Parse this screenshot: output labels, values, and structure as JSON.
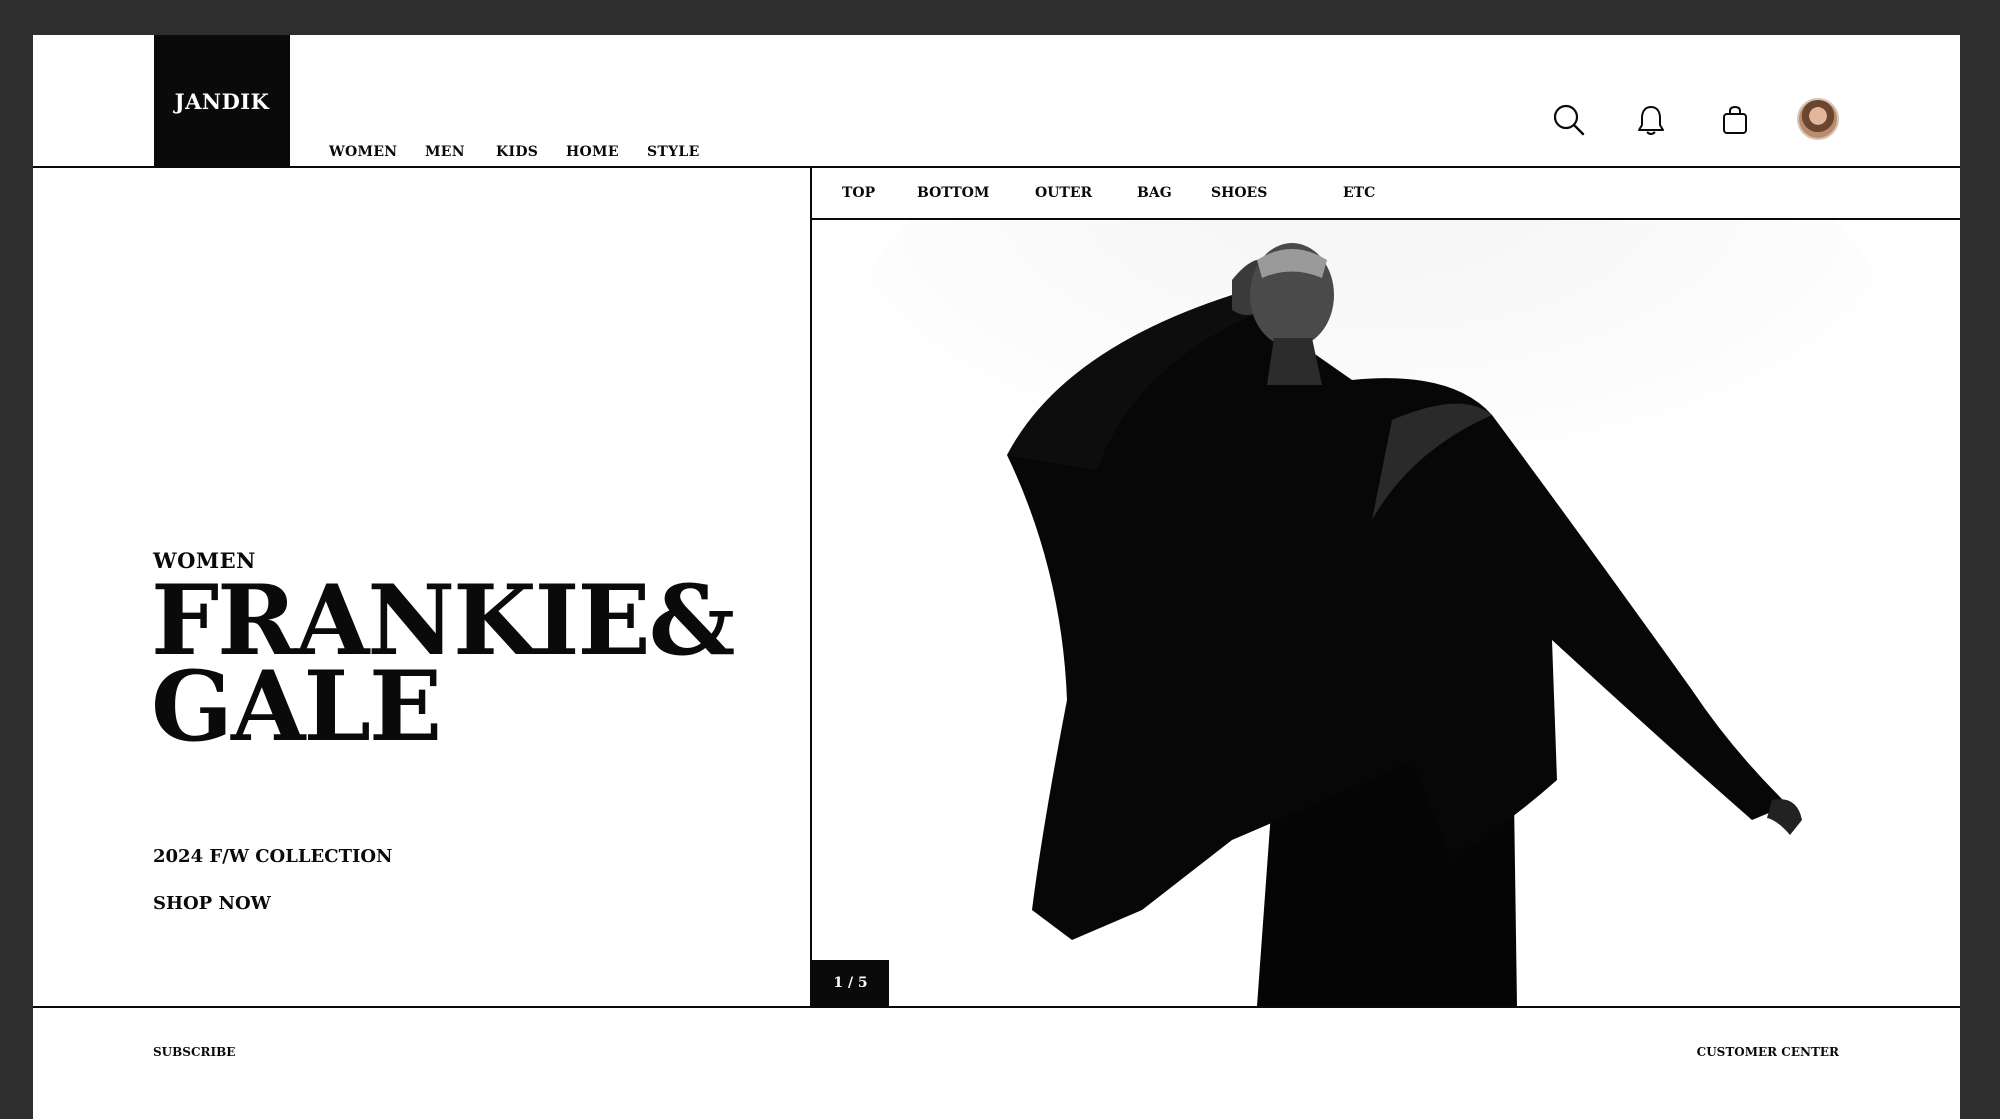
{
  "brand": {
    "logo_text": "JANDIK"
  },
  "nav": {
    "items": [
      "WOMEN",
      "MEN",
      "KIDS",
      "HOME",
      "STYLE"
    ]
  },
  "header_icons": [
    "search-icon",
    "bell-icon",
    "shopping-bag-icon",
    "avatar"
  ],
  "hero": {
    "eyebrow": "WOMEN",
    "title_line1": "FRANKIE&",
    "title_line2": "GALE",
    "collection": "2024 F/W COLLECTION",
    "cta": "SHOP NOW"
  },
  "categories": {
    "items": [
      "TOP",
      "BOTTOM",
      "OUTER",
      "BAG",
      "SHOES",
      "ETC"
    ]
  },
  "slider": {
    "current": 1,
    "total": 5,
    "label": "1 / 5"
  },
  "footer": {
    "left_link": "SUBSCRIBE",
    "right_link": "CUSTOMER CENTER"
  },
  "colors": {
    "background_frame": "#2e2e2e",
    "page": "#ffffff",
    "ink": "#0a0a0a"
  }
}
